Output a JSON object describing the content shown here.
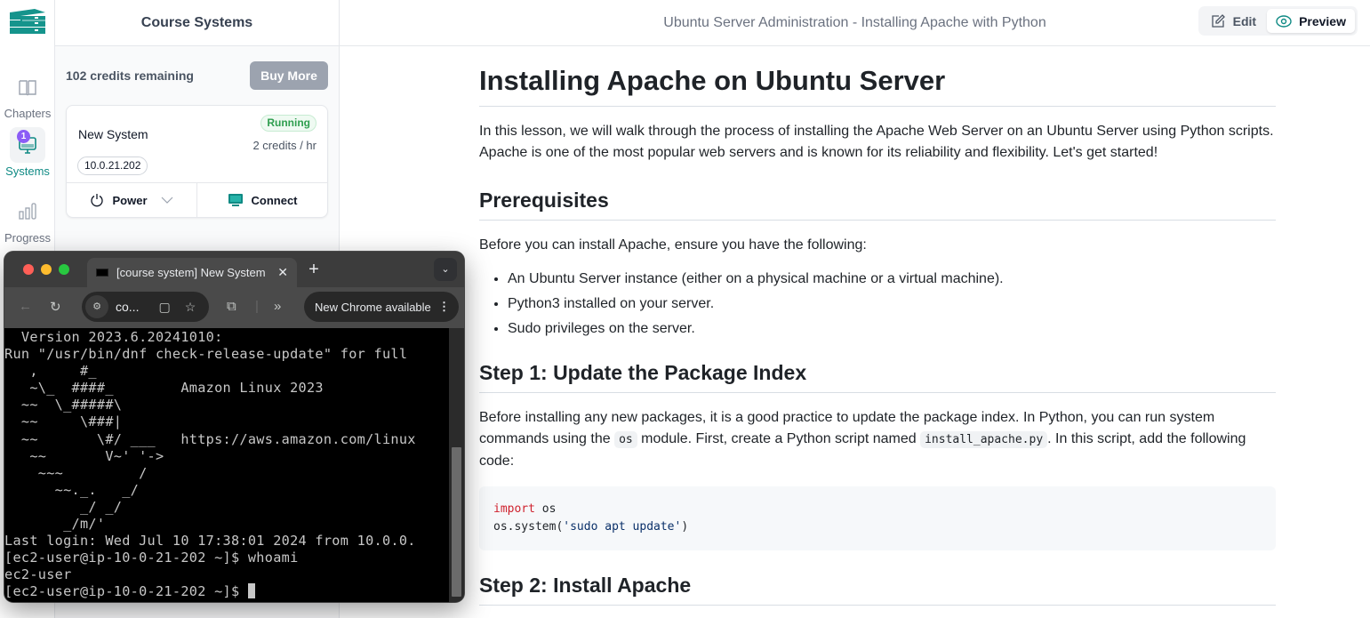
{
  "rail": {
    "items": [
      {
        "label": "Chapters",
        "icon": "book-icon",
        "active": false
      },
      {
        "label": "Systems",
        "icon": "monitor-icon",
        "active": true,
        "badge": "1"
      },
      {
        "label": "Progress",
        "icon": "bar-chart-icon",
        "active": false
      }
    ]
  },
  "systems_panel": {
    "title": "Course Systems",
    "credits_text": "102 credits remaining",
    "buy_more_label": "Buy More",
    "system": {
      "name": "New System",
      "status": "Running",
      "rate": "2 credits / hr",
      "ip": "10.0.21.202",
      "power_label": "Power",
      "connect_label": "Connect"
    }
  },
  "header": {
    "title": "Ubuntu Server Administration - Installing Apache with Python",
    "edit_label": "Edit",
    "preview_label": "Preview",
    "active_mode": "Preview"
  },
  "doc": {
    "h1": "Installing Apache on Ubuntu Server",
    "intro": "In this lesson, we will walk through the process of installing the Apache Web Server on an Ubuntu Server using Python scripts. Apache is one of the most popular web servers and is known for its reliability and flexibility. Let's get started!",
    "prereq_heading": "Prerequisites",
    "prereq_intro": "Before you can install Apache, ensure you have the following:",
    "prereq_items": [
      "An Ubuntu Server instance (either on a physical machine or a virtual machine).",
      "Python3 installed on your server.",
      "Sudo privileges on the server."
    ],
    "step1_heading": "Step 1: Update the Package Index",
    "step1_text_a": "Before installing any new packages, it is a good practice to update the package index. In Python, you can run system commands using the ",
    "step1_code_a": "os",
    "step1_text_b": " module. First, create a Python script named ",
    "step1_code_b": "install_apache.py",
    "step1_text_c": ". In this script, add the following code:",
    "code": {
      "line1_kw": "import",
      "line1_rest": " os",
      "line2_pre": "os.system(",
      "line2_str": "'sudo apt update'",
      "line2_post": ")"
    },
    "step2_heading": "Step 2: Install Apache"
  },
  "browser_window": {
    "tab_title": "[course system] New System",
    "url_short": "co...",
    "update_label": "New Chrome available",
    "terminal_lines": [
      "  Version 2023.6.20241010:",
      "Run \"/usr/bin/dnf check-release-update\" for full",
      "   ,     #_",
      "   ~\\_  ####_        Amazon Linux 2023",
      "  ~~  \\_#####\\",
      "  ~~     \\###|",
      "  ~~       \\#/ ___   https://aws.amazon.com/linux",
      "   ~~       V~' '->",
      "    ~~~         /",
      "      ~~._.   _/",
      "         _/ _/",
      "       _/m/'",
      "Last login: Wed Jul 10 17:38:01 2024 from 10.0.0.",
      "[ec2-user@ip-10-0-21-202 ~]$ whoami",
      "ec2-user",
      "[ec2-user@ip-10-0-21-202 ~]$ "
    ]
  },
  "colors": {
    "brand": "#0f8a84",
    "status_running": "#2f9e4f",
    "badge": "#8b5cf6"
  }
}
